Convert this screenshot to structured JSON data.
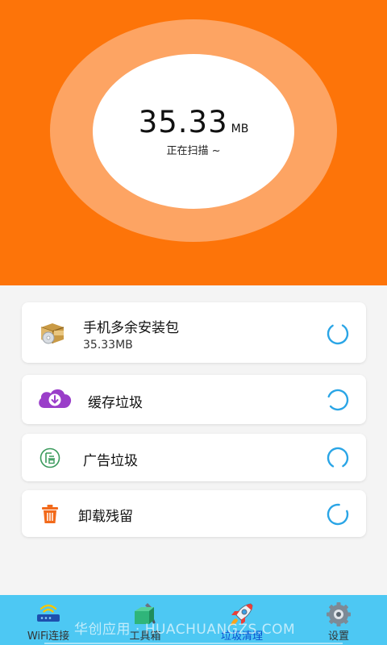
{
  "scan": {
    "size_value": "35.33",
    "size_unit": "MB",
    "status": "正在扫描 ~"
  },
  "items": [
    {
      "icon": "package-box-icon",
      "title": "手机多余安装包",
      "subtitle": "35.33MB"
    },
    {
      "icon": "cloud-download-icon",
      "title": "缓存垃圾"
    },
    {
      "icon": "ad-icon",
      "title": "广告垃圾"
    },
    {
      "icon": "trash-bin-icon",
      "title": "卸载残留"
    }
  ],
  "nav": [
    {
      "icon": "wifi-router-icon",
      "label": "WiFi连接"
    },
    {
      "icon": "toolbox-icon",
      "label": "工具箱"
    },
    {
      "icon": "rocket-icon",
      "label": "垃圾清理",
      "active": true
    },
    {
      "icon": "gear-icon",
      "label": "设置"
    }
  ],
  "watermark": "华创应用 · HUACHUANGZS.COM",
  "colors": {
    "header": "#fd7409",
    "ring": "#fda463",
    "spinner": "#2aa5e6",
    "nav_bg": "#4dc8f3",
    "nav_active": "#0c4fd0"
  }
}
